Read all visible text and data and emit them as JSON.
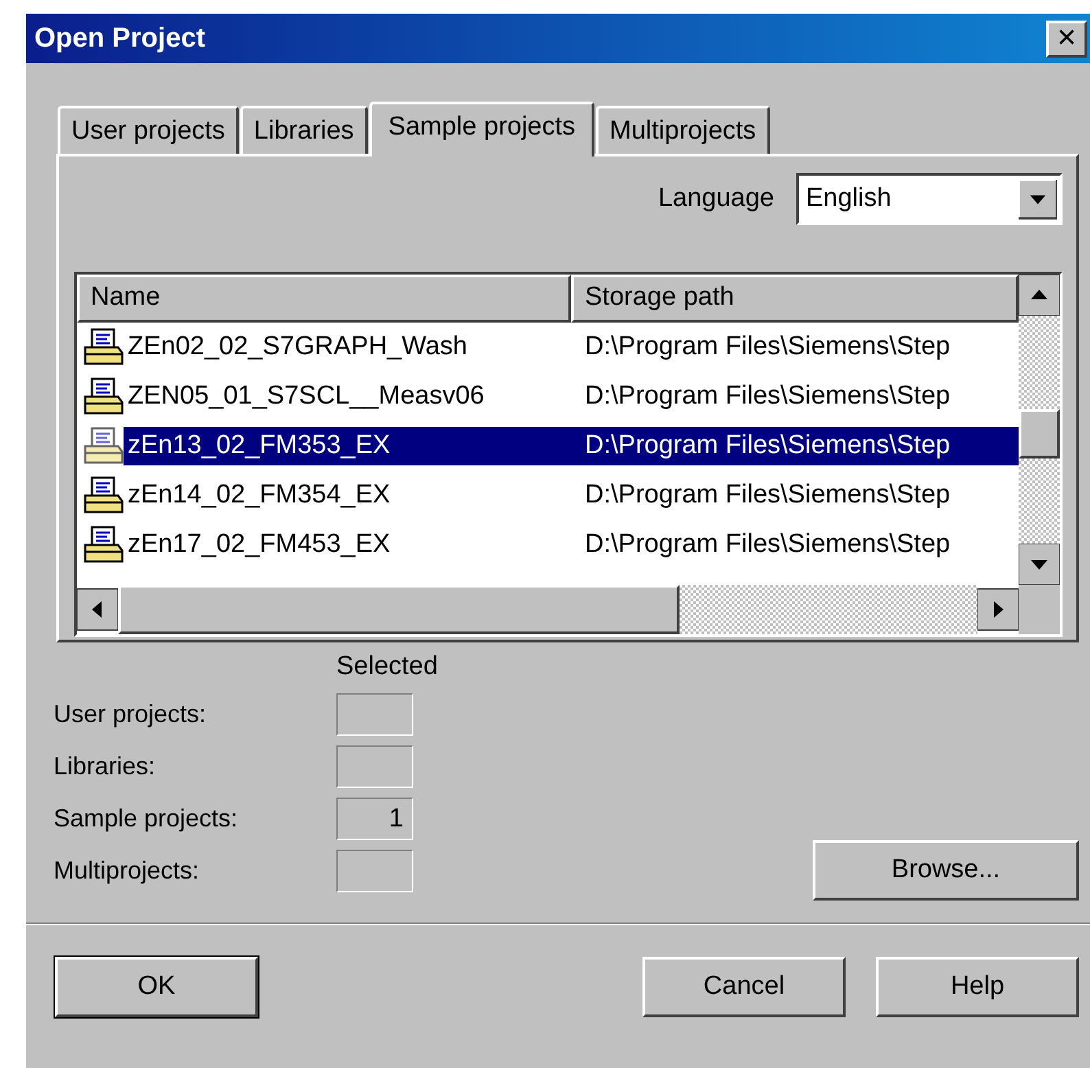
{
  "window": {
    "title": "Open Project",
    "close": "×"
  },
  "tabs": [
    {
      "label": "User projects",
      "selected": false
    },
    {
      "label": "Libraries",
      "selected": false
    },
    {
      "label": "Sample projects",
      "selected": true
    },
    {
      "label": "Multiprojects",
      "selected": false
    }
  ],
  "language": {
    "label": "Language",
    "value": "English"
  },
  "list": {
    "columns": [
      "Name",
      "Storage path"
    ],
    "rows": [
      {
        "name": "ZEn02_02_S7GRAPH_Wash",
        "path": "D:\\Program Files\\Siemens\\Step",
        "selected": false
      },
      {
        "name": "ZEN05_01_S7SCL__Measv06",
        "path": "D:\\Program Files\\Siemens\\Step",
        "selected": false
      },
      {
        "name": "zEn13_02_FM353_EX",
        "path": "D:\\Program Files\\Siemens\\Step",
        "selected": true
      },
      {
        "name": "zEn14_02_FM354_EX",
        "path": "D:\\Program Files\\Siemens\\Step",
        "selected": false
      },
      {
        "name": "zEn17_02_FM453_EX",
        "path": "D:\\Program Files\\Siemens\\Step",
        "selected": false
      }
    ]
  },
  "summary": {
    "heading": "Selected",
    "rows": [
      {
        "label": "User projects:",
        "value": ""
      },
      {
        "label": "Libraries:",
        "value": ""
      },
      {
        "label": "Sample projects:",
        "value": "1"
      },
      {
        "label": "Multiprojects:",
        "value": ""
      }
    ]
  },
  "buttons": {
    "browse": "Browse...",
    "ok": "OK",
    "cancel": "Cancel",
    "help": "Help"
  }
}
